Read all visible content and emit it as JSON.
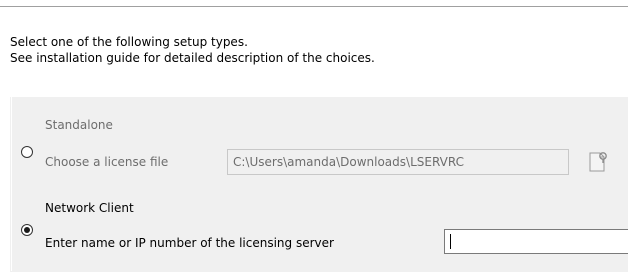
{
  "instructions": {
    "line1": "Select one of the following setup types.",
    "line2": "See installation guide for detailed description of the choices."
  },
  "options": {
    "standalone": {
      "label": "Standalone",
      "selected": false,
      "enabled": false,
      "license_file_label": "Choose a license file",
      "license_file_value": "C:\\Users\\amanda\\Downloads\\LSERVRC",
      "browse_icon": "browse-file-icon"
    },
    "network_client": {
      "label": "Network Client",
      "selected": true,
      "enabled": true,
      "server_label": "Enter name or IP number of the licensing server",
      "server_value": ""
    }
  },
  "colors": {
    "group_background": "#f0f0f0",
    "disabled_text": "#6d6d6d"
  }
}
